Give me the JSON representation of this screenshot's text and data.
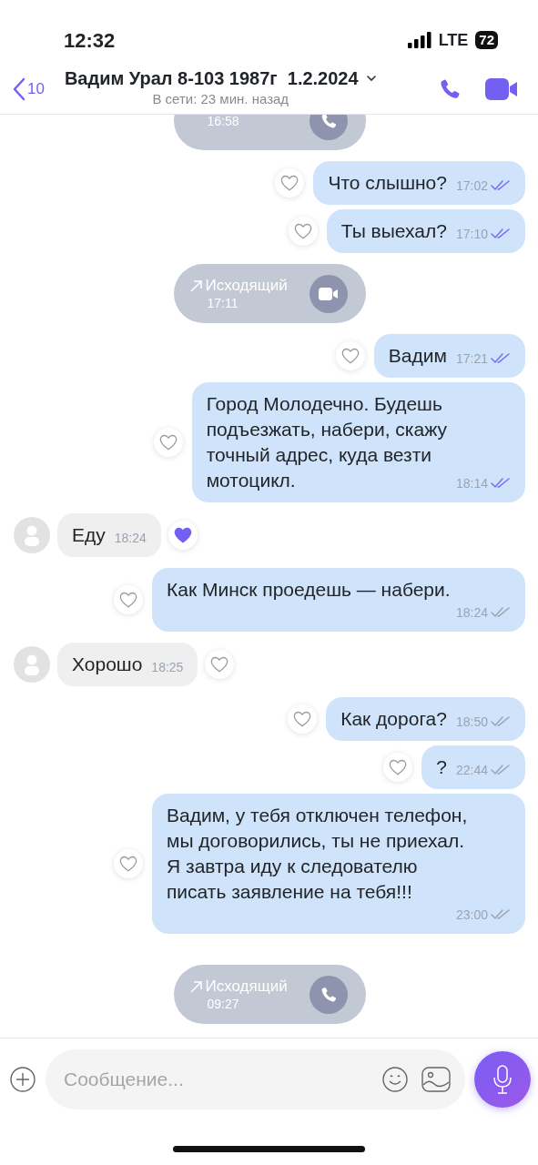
{
  "status_bar": {
    "time": "12:32",
    "network": "LTE",
    "battery": "72"
  },
  "header": {
    "back_count": "10",
    "title": "Вадим Урал 8-103 1987г  1.2.2024",
    "subtitle": "В сети: 23 мин. назад"
  },
  "messages": [
    {
      "kind": "call",
      "time": "16:58",
      "video": false
    },
    {
      "kind": "out",
      "text": "Что слышно?",
      "time": "17:02",
      "seen": true,
      "liked": false
    },
    {
      "kind": "out",
      "text": "Ты выехал?",
      "time": "17:10",
      "seen": true,
      "liked": false
    },
    {
      "kind": "call",
      "label": "Исходящий",
      "time": "17:11",
      "video": true
    },
    {
      "kind": "out",
      "text": "Вадим",
      "time": "17:21",
      "seen": true,
      "liked": false
    },
    {
      "kind": "out",
      "text": "Город Молодечно. Будешь\nподъезжать, набери, скажу\nточный адрес, куда везти\nмотоцикл.",
      "time": "18:14",
      "seen": true,
      "liked": false
    },
    {
      "kind": "in",
      "text": "Еду",
      "time": "18:24",
      "liked": true
    },
    {
      "kind": "out",
      "text": "Как Минск проедешь — набери.",
      "time": "18:24",
      "seen": false,
      "liked": false
    },
    {
      "kind": "in",
      "text": "Хорошо",
      "time": "18:25",
      "liked": false
    },
    {
      "kind": "out",
      "text": "Как дорога?",
      "time": "18:50",
      "seen": false,
      "liked": false
    },
    {
      "kind": "out",
      "text": "?",
      "time": "22:44",
      "seen": false,
      "liked": false
    },
    {
      "kind": "out",
      "text": "Вадим, у тебя отключен телефон,\nмы договорились, ты не приехал.\nЯ завтра иду к следователю\nписать заявление на тебя!!!",
      "time": "23:00",
      "seen": false,
      "liked": false
    },
    {
      "kind": "call",
      "label": "Исходящий",
      "time": "09:27",
      "video": false
    }
  ],
  "composer": {
    "placeholder": "Сообщение..."
  }
}
